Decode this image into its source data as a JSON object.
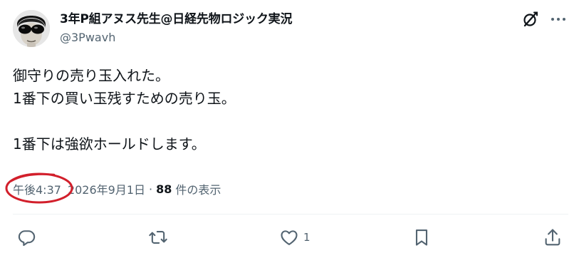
{
  "author": {
    "display_name": "3年P組アヌス先生@日経先物ロジック実況",
    "handle": "@3Pwavh"
  },
  "tweet": {
    "lines": [
      "御守りの売り玉入れた。",
      "1番下の買い玉残すための売り玉。",
      "",
      "1番下は強欲ホールドします。"
    ]
  },
  "meta": {
    "time": "午後4:37",
    "date": "2026年9月1日",
    "separator": "·",
    "views_count": "88",
    "views_label": "件の表示"
  },
  "actions": {
    "likes_count": "1"
  },
  "colors": {
    "text": "#0f1419",
    "secondary": "#536471",
    "annotation_circle": "#d21f2b"
  },
  "icons": [
    "grok-icon",
    "more-icon",
    "reply-icon",
    "retweet-icon",
    "like-icon",
    "bookmark-icon",
    "share-icon"
  ]
}
